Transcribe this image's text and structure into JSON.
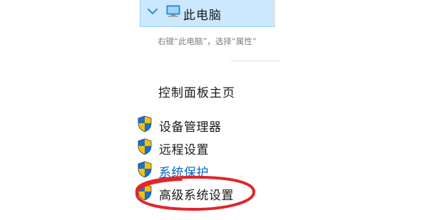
{
  "explorer": {
    "item_label": "此电脑",
    "item_icon": "computer-icon",
    "expand_icon": "chevron-down-icon"
  },
  "instruction": {
    "text": "右键“此电脑”，选择“属性”"
  },
  "control_panel": {
    "home_label": "控制面板主页",
    "links": [
      {
        "label": "设备管理器",
        "icon": "uac-shield-icon"
      },
      {
        "label": "远程设置",
        "icon": "uac-shield-icon"
      },
      {
        "label": "系统保护",
        "icon": "uac-shield-icon"
      },
      {
        "label": "高级系统设置",
        "icon": "uac-shield-icon"
      }
    ]
  },
  "colors": {
    "selection_bg": "#cce8ff",
    "selection_border": "#99d1ff",
    "link": "#0066cc",
    "annotation": "#e0262b",
    "shield_blue": "#1f6fc5",
    "shield_yellow": "#f6c100"
  }
}
